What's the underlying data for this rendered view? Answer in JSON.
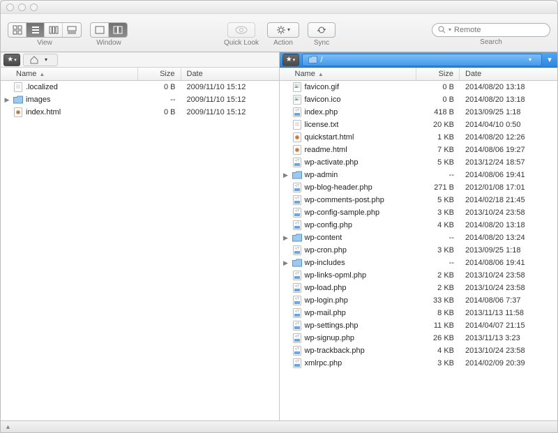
{
  "toolbar": {
    "view_label": "View",
    "window_label": "Window",
    "quicklook_label": "Quick Look",
    "action_label": "Action",
    "sync_label": "Sync",
    "search_label": "Search",
    "search_placeholder": "Remote"
  },
  "columns": {
    "name": "Name",
    "size": "Size",
    "date": "Date"
  },
  "left": {
    "path_label": "",
    "files": [
      {
        "tri": "",
        "icon": "file",
        "name": ".localized",
        "size": "0 B",
        "date": "2009/11/10 15:12"
      },
      {
        "tri": "▶",
        "icon": "folder",
        "name": "images",
        "size": "--",
        "date": "2009/11/10 15:12"
      },
      {
        "tri": "",
        "icon": "html",
        "name": "index.html",
        "size": "0 B",
        "date": "2009/11/10 15:12"
      }
    ]
  },
  "right": {
    "path_label": "/",
    "files": [
      {
        "tri": "",
        "icon": "img",
        "name": "favicon.gif",
        "size": "0 B",
        "date": "2014/08/20 13:18"
      },
      {
        "tri": "",
        "icon": "img",
        "name": "favicon.ico",
        "size": "0 B",
        "date": "2014/08/20 13:18"
      },
      {
        "tri": "",
        "icon": "php",
        "name": "index.php",
        "size": "418 B",
        "date": "2013/09/25 1:18"
      },
      {
        "tri": "",
        "icon": "file",
        "name": "license.txt",
        "size": "20 KB",
        "date": "2014/04/10 0:50"
      },
      {
        "tri": "",
        "icon": "html",
        "name": "quickstart.html",
        "size": "1 KB",
        "date": "2014/08/20 12:26"
      },
      {
        "tri": "",
        "icon": "html",
        "name": "readme.html",
        "size": "7 KB",
        "date": "2014/08/06 19:27"
      },
      {
        "tri": "",
        "icon": "php",
        "name": "wp-activate.php",
        "size": "5 KB",
        "date": "2013/12/24 18:57"
      },
      {
        "tri": "▶",
        "icon": "folder",
        "name": "wp-admin",
        "size": "--",
        "date": "2014/08/06 19:41"
      },
      {
        "tri": "",
        "icon": "php",
        "name": "wp-blog-header.php",
        "size": "271 B",
        "date": "2012/01/08 17:01"
      },
      {
        "tri": "",
        "icon": "php",
        "name": "wp-comments-post.php",
        "size": "5 KB",
        "date": "2014/02/18 21:45"
      },
      {
        "tri": "",
        "icon": "php",
        "name": "wp-config-sample.php",
        "size": "3 KB",
        "date": "2013/10/24 23:58"
      },
      {
        "tri": "",
        "icon": "php",
        "name": "wp-config.php",
        "size": "4 KB",
        "date": "2014/08/20 13:18"
      },
      {
        "tri": "▶",
        "icon": "folder",
        "name": "wp-content",
        "size": "--",
        "date": "2014/08/20 13:24"
      },
      {
        "tri": "",
        "icon": "php",
        "name": "wp-cron.php",
        "size": "3 KB",
        "date": "2013/09/25 1:18"
      },
      {
        "tri": "▶",
        "icon": "folder",
        "name": "wp-includes",
        "size": "--",
        "date": "2014/08/06 19:41"
      },
      {
        "tri": "",
        "icon": "php",
        "name": "wp-links-opml.php",
        "size": "2 KB",
        "date": "2013/10/24 23:58"
      },
      {
        "tri": "",
        "icon": "php",
        "name": "wp-load.php",
        "size": "2 KB",
        "date": "2013/10/24 23:58"
      },
      {
        "tri": "",
        "icon": "php",
        "name": "wp-login.php",
        "size": "33 KB",
        "date": "2014/08/06 7:37"
      },
      {
        "tri": "",
        "icon": "php",
        "name": "wp-mail.php",
        "size": "8 KB",
        "date": "2013/11/13 11:58"
      },
      {
        "tri": "",
        "icon": "php",
        "name": "wp-settings.php",
        "size": "11 KB",
        "date": "2014/04/07 21:15"
      },
      {
        "tri": "",
        "icon": "php",
        "name": "wp-signup.php",
        "size": "26 KB",
        "date": "2013/11/13 3:23"
      },
      {
        "tri": "",
        "icon": "php",
        "name": "wp-trackback.php",
        "size": "4 KB",
        "date": "2013/10/24 23:58"
      },
      {
        "tri": "",
        "icon": "php",
        "name": "xmlrpc.php",
        "size": "3 KB",
        "date": "2014/02/09 20:39"
      }
    ]
  }
}
